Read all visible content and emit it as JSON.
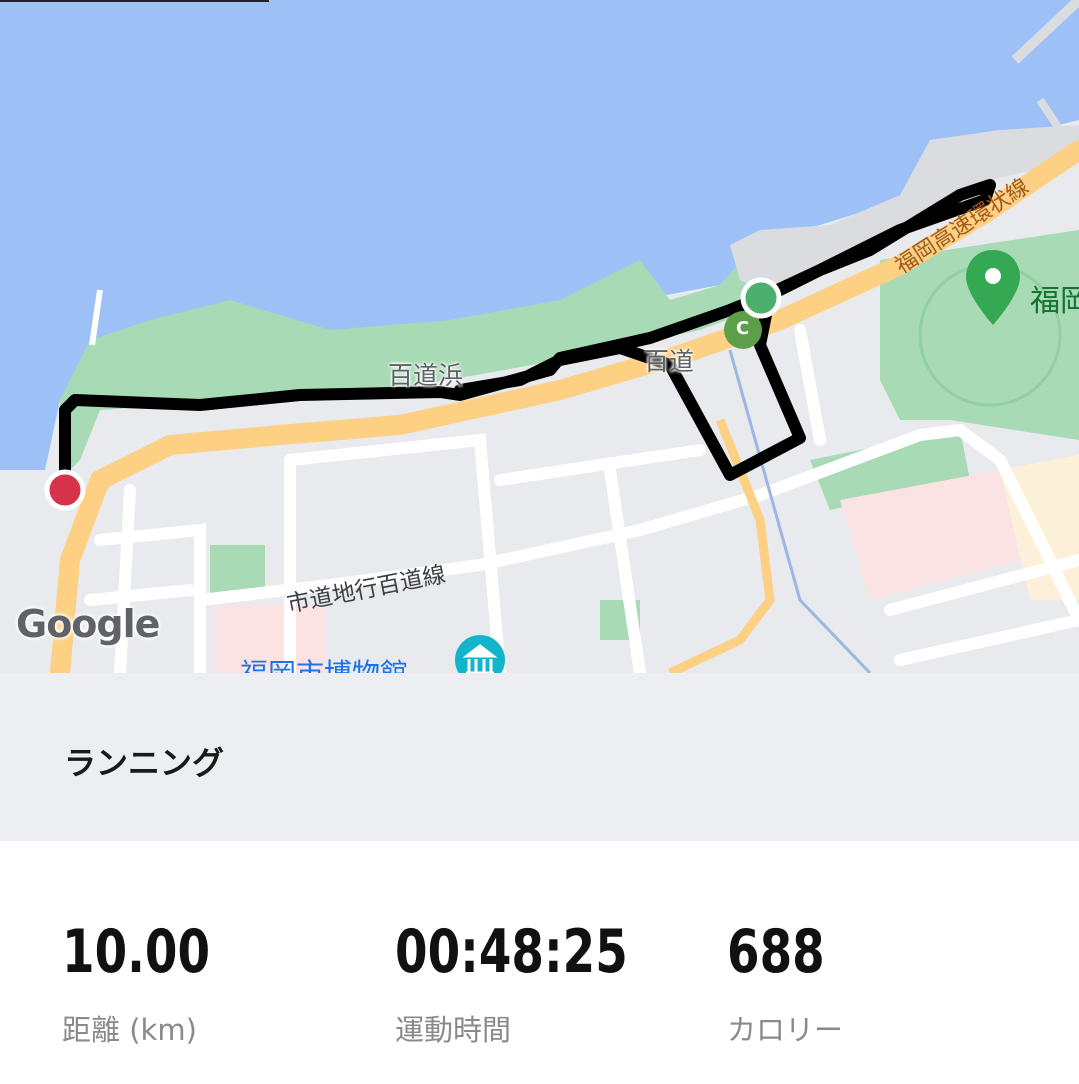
{
  "map": {
    "labels": {
      "momochihama": "百道浜",
      "momochi": "百道",
      "expressway": "福岡高速環状線",
      "street": "市道地行百道線",
      "park": "福岡",
      "museum": "福岡市博物館",
      "marker_c": "C"
    },
    "attribution": "Google",
    "route_color": "#000000",
    "start_marker_color": "#4caf6e",
    "end_marker_color": "#d6334a",
    "water_color": "#9dc1f7",
    "park_color": "#a8dab5",
    "road_color": "#fdd083"
  },
  "activity": {
    "type": "ランニング"
  },
  "stats": {
    "distance": {
      "value": "10.00",
      "label": "距離 (km)"
    },
    "duration": {
      "value": "00:48:25",
      "label": "運動時間"
    },
    "calories": {
      "value": "688",
      "label": "カロリー"
    }
  }
}
